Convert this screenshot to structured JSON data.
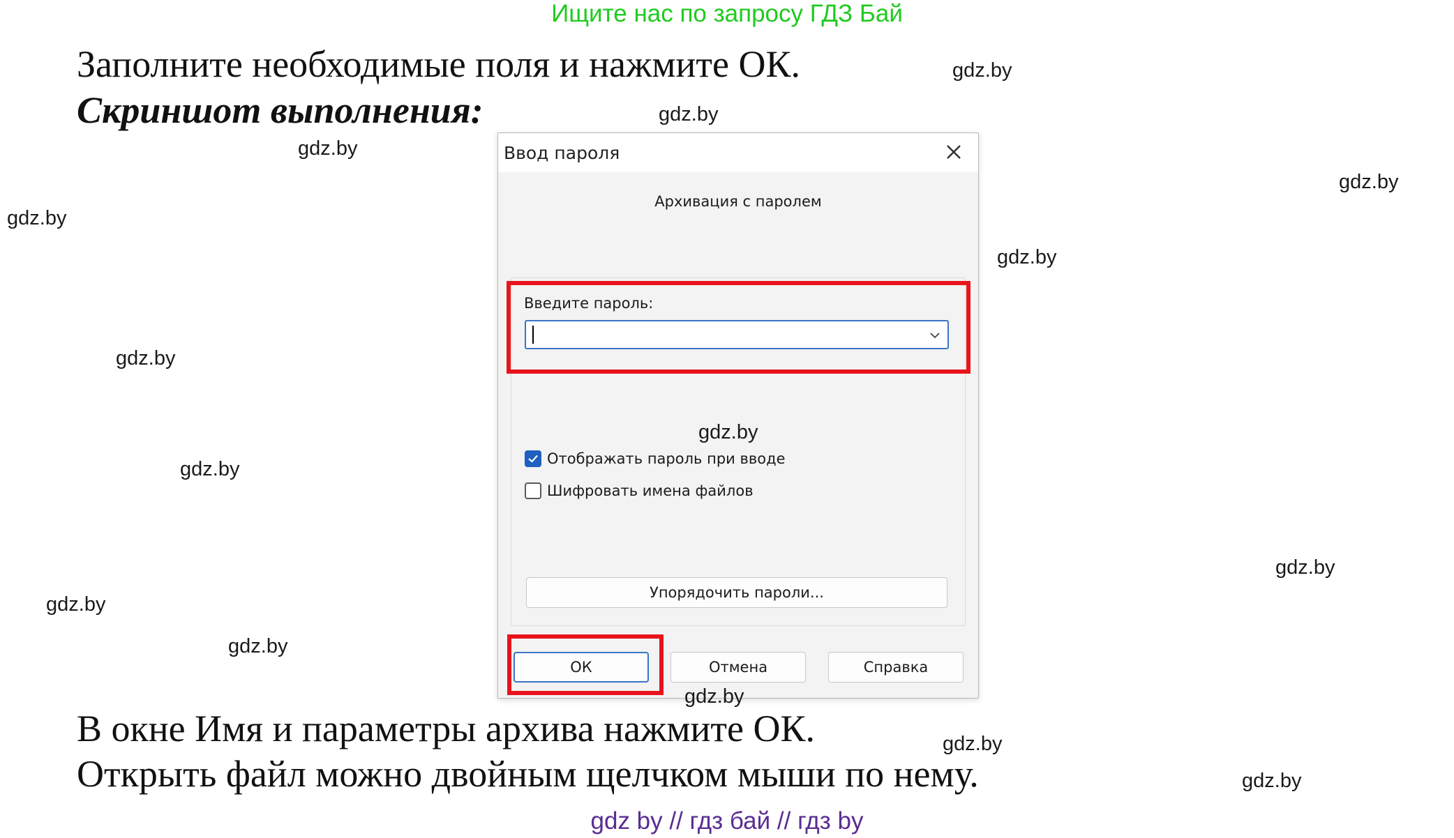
{
  "promo": {
    "top": "Ищите нас по запросу ГДЗ Бай",
    "bottom": "gdz by  //  гдз бай  //  гдз by"
  },
  "doc": {
    "line1": "Заполните необходимые поля и нажмите ОК.",
    "heading": "Скриншот выполнения:",
    "line3": "В окне Имя и параметры архива нажмите ОК.",
    "line4": "Открыть файл можно двойным щелчком мыши по нему."
  },
  "watermark": "gdz.by",
  "dialog": {
    "title": "Ввод пароля",
    "subtitle": "Архивация с паролем",
    "password_label": "Введите пароль:",
    "password_value": "",
    "show_password_label": "Отображать пароль при вводе",
    "show_password_checked": true,
    "encrypt_names_label": "Шифровать имена файлов",
    "encrypt_names_checked": false,
    "organize_button": "Упорядочить пароли...",
    "ok_button": "ОК",
    "cancel_button": "Отмена",
    "help_button": "Справка"
  },
  "colors": {
    "highlight": "#e8141c",
    "accent": "#1f5fbf",
    "promo_top": "#1fcb1f",
    "promo_bottom": "#5a2d91"
  }
}
